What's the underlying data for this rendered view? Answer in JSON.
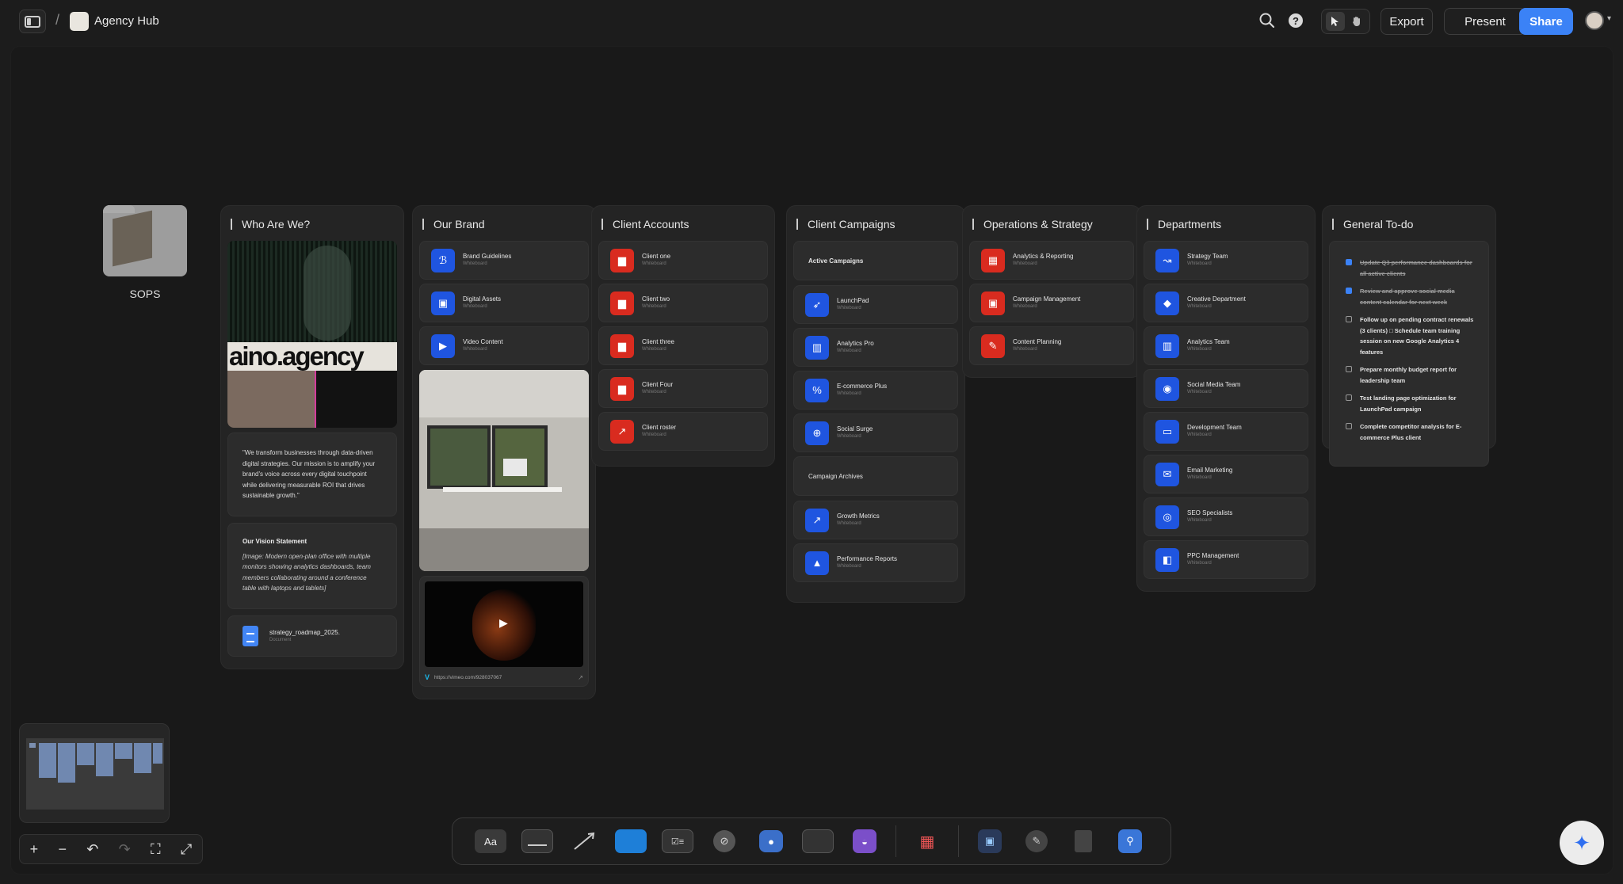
{
  "header": {
    "separator": "/",
    "title": "Agency Hub",
    "export_label": "Export",
    "present_label": "Present",
    "share_label": "Share"
  },
  "sops": {
    "label": "SOPS"
  },
  "columns": {
    "who": {
      "title": "Who Are We?",
      "image_text": "aino.agency",
      "quote": "\"We transform businesses through data-driven digital strategies. Our mission is to amplify your brand's voice across every digital touchpoint while delivering measurable ROI that drives sustainable growth.\"",
      "vision_title": "Our Vision Statement",
      "vision_body": "[Image: Modern open-plan office with multiple monitors showing analytics dashboards, team members collaborating around a conference table with laptops and tablets]",
      "doc_name": "strategy_roadmap_2025.",
      "doc_type": "Document"
    },
    "brand": {
      "title": "Our Brand",
      "items": [
        {
          "name": "Brand Guidelines",
          "sub": "Whiteboard"
        },
        {
          "name": "Digital Assets",
          "sub": "Whiteboard"
        },
        {
          "name": "Video Content",
          "sub": "Whiteboard"
        }
      ],
      "video_url": "https://vimeo.com/928037067"
    },
    "clients": {
      "title": "Client Accounts",
      "items": [
        {
          "name": "Client one",
          "sub": "Whiteboard"
        },
        {
          "name": "Client two",
          "sub": "Whiteboard"
        },
        {
          "name": "Client three",
          "sub": "Whiteboard"
        },
        {
          "name": "Client Four",
          "sub": "Whiteboard"
        },
        {
          "name": "Client roster",
          "sub": "Whiteboard"
        }
      ]
    },
    "campaigns": {
      "title": "Client Campaigns",
      "active_label": "Active Campaigns",
      "active": [
        {
          "name": "LaunchPad",
          "sub": "Whiteboard"
        },
        {
          "name": "Analytics Pro",
          "sub": "Whiteboard"
        },
        {
          "name": "E-commerce Plus",
          "sub": "Whiteboard"
        },
        {
          "name": "Social Surge",
          "sub": "Whiteboard"
        }
      ],
      "archive_label": "Campaign Archives",
      "archives": [
        {
          "name": "Growth Metrics",
          "sub": "Whiteboard"
        },
        {
          "name": "Performance Reports",
          "sub": "Whiteboard"
        }
      ]
    },
    "ops": {
      "title": "Operations & Strategy",
      "items": [
        {
          "name": "Analytics & Reporting",
          "sub": "Whiteboard"
        },
        {
          "name": "Campaign Management",
          "sub": "Whiteboard"
        },
        {
          "name": "Content Planning",
          "sub": "Whiteboard"
        }
      ]
    },
    "departments": {
      "title": "Departments",
      "items": [
        {
          "name": "Strategy Team",
          "sub": "Whiteboard"
        },
        {
          "name": "Creative Department",
          "sub": "Whiteboard"
        },
        {
          "name": "Analytics Team",
          "sub": "Whiteboard"
        },
        {
          "name": "Social Media Team",
          "sub": "Whiteboard"
        },
        {
          "name": "Development Team",
          "sub": "Whiteboard"
        },
        {
          "name": "Email Marketing",
          "sub": "Whiteboard"
        },
        {
          "name": "SEO Specialists",
          "sub": "Whiteboard"
        },
        {
          "name": "PPC Management",
          "sub": "Whiteboard"
        }
      ]
    },
    "todo": {
      "title": "General To-do",
      "items": [
        {
          "text": "Update Q3 performance dashboards for all active clients",
          "done": true
        },
        {
          "text": "Review and approve social media content calendar for next week",
          "done": true
        },
        {
          "text": "Follow up on pending contract renewals (3 clients) □ Schedule team training session on new Google Analytics 4 features",
          "done": false
        },
        {
          "text": "Prepare monthly budget report for leadership team",
          "done": false
        },
        {
          "text": "Test landing page optimization for LaunchPad campaign",
          "done": false
        },
        {
          "text": "Complete competitor analysis for E-commerce Plus client",
          "done": false
        }
      ]
    }
  },
  "toolbar": {
    "text_tool_label": "Aa"
  },
  "colors": {
    "accent": "#3b82f6",
    "blue_icon": "#1f55e0",
    "red_icon": "#d92b1f"
  }
}
